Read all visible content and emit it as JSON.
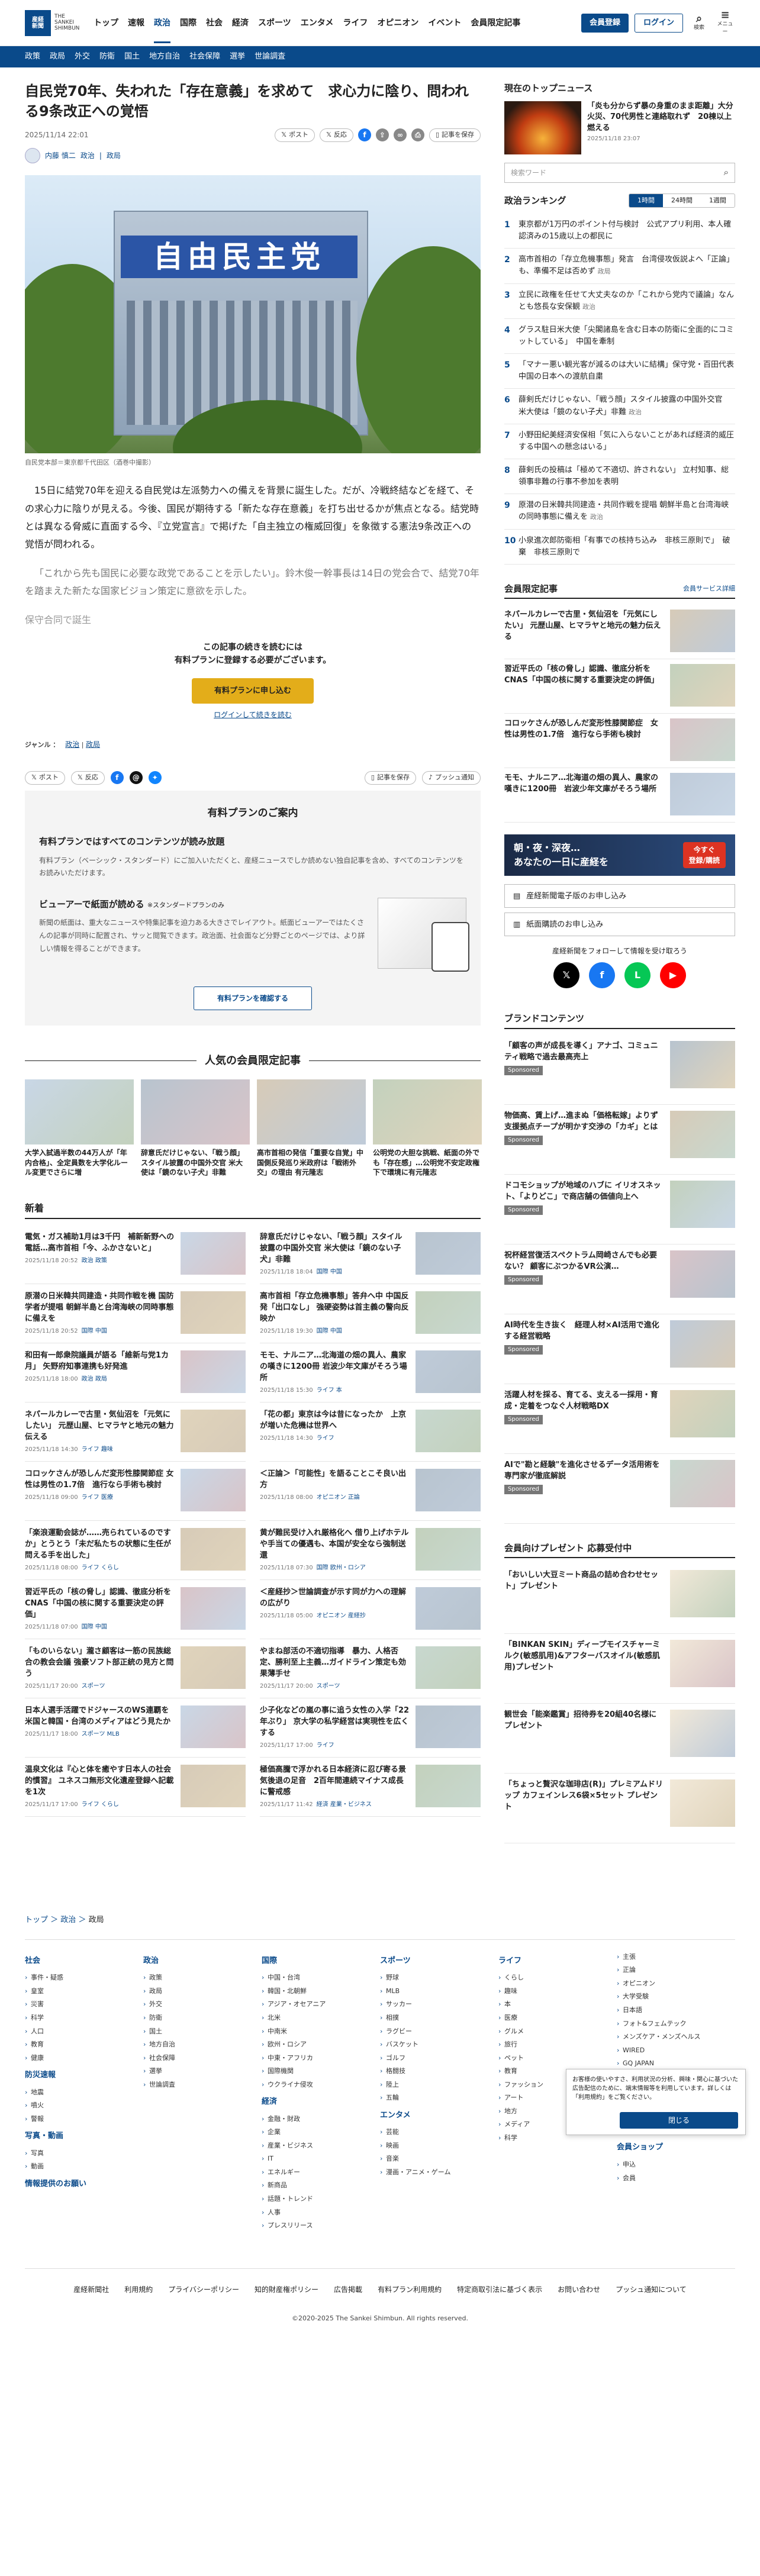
{
  "header": {
    "logo_top": "産経",
    "logo_bottom": "新聞",
    "logo_sub": "THE SANKEI SHIMBUN",
    "nav": [
      "トップ",
      "速報",
      "政治",
      "国際",
      "社会",
      "経済",
      "スポーツ",
      "エンタメ",
      "ライフ",
      "オピニオン",
      "イベント",
      "会員限定記事"
    ],
    "register": "会員登録",
    "login": "ログイン",
    "search_label": "検索",
    "menu_label": "メニュー"
  },
  "subnav": [
    "政策",
    "政局",
    "外交",
    "防衛",
    "国土",
    "地方自治",
    "社会保障",
    "選挙",
    "世論調査"
  ],
  "article": {
    "title": "自民党70年、失われた「存在意義」を求めて　求心力に陰り、問われる9条改正への覚悟",
    "date": "2025/11/14 22:01",
    "post": "ポスト",
    "anti": "反応",
    "save": "記事を保存",
    "author": "内藤 慎二",
    "cats": [
      "政治",
      "政局"
    ],
    "sign_text": "自由民主党",
    "caption": "自民党本部＝東京都千代田区（酒巻中撮影）",
    "p1": "15日に結党70年を迎える自民党は左派勢力への備えを背景に誕生した。だが、冷戦終結などを経て、その求心力に陰りが見える。今後、国民が期待する「新たな存在意義」を打ち出せるかが焦点となる。結党時とは異なる脅威に直面する今、『立党宣言』で掲げた「自主独立の権威回復」を象徴する憲法9条改正への覚悟が問われる。",
    "p2": "「これから先も国民に必要な政党であることを示したい」。鈴木俊一幹事長は14日の党会合で、結党70年を踏まえた新たな国家ビジョン策定に意欲を示した。",
    "fade": "保守合同で誕生",
    "pay1": "この記事の続きを読むには",
    "pay2": "有料プランに登録する必要がございます。",
    "pay_btn": "有料プランに申し込む",
    "pay_login": "ログインして続きを読む",
    "genre_label": "ジャンル ：",
    "genre": [
      "政治",
      "政局"
    ],
    "push": "プッシュ通知"
  },
  "plan": {
    "title": "有料プランのご案内",
    "h1": "有料プランではすべてのコンテンツが読み放題",
    "p1": "有料プラン（ベーシック・スタンダード）にご加入いただくと、産経ニュースでしか読めない独自記事を含め、すべてのコンテンツをお読みいただけます。",
    "h2": "ビューアーで紙面が読める",
    "h2sub": "※スタンダードプランのみ",
    "p2": "新聞の紙面は、重大なニュースや特集記事を迫力ある大きさでレイアウト。紙面ビューアーではたくさんの記事が同時に配置され、サッと閲覧できます。政治面、社会面など分野ごとのページでは、より詳しい情報を得ることができます。",
    "btn": "有料プランを確認する"
  },
  "popular": {
    "title": "人気の会員限定記事",
    "items": [
      "大学入試過半数の44万人が「年内合格」、全定員数を大学化ルール変更でさらに増",
      "辞意氏だけじゃない、「戦う顔」スタイル披露の中国外交官 米大使は「鏡のない子犬」非難",
      "高市首相の発信「重要な自覚」中国側反発巡り米政府は「戦術外交」の理由 有元隆志",
      "公明党の大胆な挑戦、紙面の外でも「存在感」…公明党不安定政権下で環境に有元隆志"
    ]
  },
  "news": {
    "title": "新着",
    "items": [
      {
        "t": "電気・ガス補助1月は3千円　補新新野への電話…高市首相「今、ふかさないと」",
        "d": "2025/11/18 20:52",
        "c": "政治 政策"
      },
      {
        "t": "辞意氏だけじゃない、「戦う顔」スタイル披露の中国外交官 米大使は「鏡のない子犬」非難",
        "d": "2025/11/18 18:04",
        "c": "国際 中国"
      },
      {
        "t": "原潜の日米韓共同建造・共同作戦を機 国防学者が提唱 朝鮮半島と台湾海峡の同時事態に備えを",
        "d": "2025/11/18 20:52",
        "c": "国際 中国"
      },
      {
        "t": "高市首相「存立危機事態」答弁へ中 中国反発「出口なし」 強硬姿勢は首主義の警向反映か",
        "d": "2025/11/18 19:30",
        "c": "国際 中国"
      },
      {
        "t": "和田有一郎衆院議員が語る「維新与党1カ月」 矢野府知事連携も好発進",
        "d": "2025/11/18 18:00",
        "c": "政治 政局"
      },
      {
        "t": "モモ、ナルニア…北海道の畑の異人、農家の嘆きに1200冊 岩波少年文庫がそろう場所",
        "d": "2025/11/18 15:30",
        "c": "ライフ 本"
      },
      {
        "t": "ネパールカレーで古里・気仙沼を「元気にしたい」 元歴山屋、ヒマラヤと地元の魅力伝える",
        "d": "2025/11/18 14:30",
        "c": "ライフ 趣味"
      },
      {
        "t": "「花の都」東京は今は昔になったか　上京が増いた危機は世界へ",
        "d": "2025/11/18 14:30",
        "c": "ライフ"
      },
      {
        "t": "コロッケさんが恐しんだ変形性膝関節症 女性は男性の1.7倍　進行なら手術も検討",
        "d": "2025/11/18 09:00",
        "c": "ライフ 医療"
      },
      {
        "t": "＜正論＞「可能性」を語ることこそ良い出方",
        "d": "2025/11/18 08:00",
        "c": "オピニオン 正論"
      },
      {
        "t": "「楽浪運動会誌が……売られているのですか」とうとう「未だ私たちの状態に生任が問える手を出した」",
        "d": "2025/11/18 08:00",
        "c": "ライフ くらし"
      },
      {
        "t": "黄が難民受け入れ厳格化へ 借り上げホテルや手当ての優遇も、本国が安全なら強制送還",
        "d": "2025/11/18 07:30",
        "c": "国際 欧州・ロシア"
      },
      {
        "t": "習近平氏の「核の脅し」認識、徹底分析を　CNAS「中国の核に関する重要決定の評価」",
        "d": "2025/11/18 07:00",
        "c": "国際 中国"
      },
      {
        "t": "＜産経抄＞世論調査が示す同が力への理解の広がり",
        "d": "2025/11/18 05:00",
        "c": "オピニオン 産経抄"
      },
      {
        "t": "「ものいらない」瀧さ顧客は一筋の民族総合の教会会議 強豪ソフト部正統の見方と問う",
        "d": "2025/11/17 20:00",
        "c": "スポーツ"
      },
      {
        "t": "やまね部活の不適切指導　暴力、人格否定、勝利至上主義…ガイドライン策定も効果薄手せ",
        "d": "2025/11/17 20:00",
        "c": "スポーツ"
      },
      {
        "t": "日本人選手活躍でドジャースのWS連覇を米国と韓国・台湾のメディアはどう見たか",
        "d": "2025/11/17 18:00",
        "c": "スポーツ MLB"
      },
      {
        "t": "少子化などの嵐の事に追う女性の入学「22年ぶり」 京大学の私学経営は実現性を広くする",
        "d": "2025/11/17 17:00",
        "c": "ライフ"
      },
      {
        "t": "温泉文化は『心と体を癒やす日本人の社会的慣習』 ユネスコ無形文化遺産登録へ記載を1次",
        "d": "2025/11/17 17:00",
        "c": "ライフ くらし"
      },
      {
        "t": "極価高騰で浮かれる日本経済に忍び寄る景気後退の足音　2百年間連続マイナス成長に警戒感",
        "d": "2025/11/17 11:42",
        "c": "経済 産業・ビジネス"
      }
    ]
  },
  "sidebar": {
    "top_title": "現在のトップニュース",
    "top": {
      "t": "「炎も分からず暴の身重のまま距離」大分火災、70代男性と連絡取れず　20棟以上燃える",
      "d": "2025/11/18 23:07"
    },
    "search_ph": "検索ワード",
    "rank_title": "政治ランキング",
    "tabs": [
      "1時間",
      "24時間",
      "1週間"
    ],
    "rank": [
      {
        "t": "東京都が1万円のポイント付与検討　公式アプリ利用、本人確認済みの15歳以上の都民に",
        "k": ""
      },
      {
        "t": "高市首相の「存立危機事態」発言　台湾侵攻仮説よへ「正論」も、準備不足は否めず",
        "k": "政局"
      },
      {
        "t": "立民に政権を任せて大丈夫なのか「これから党内で議論」なんとも悠長な安保観",
        "k": "政治"
      },
      {
        "t": "グラス駐日米大使「尖閣諸島を含む日本の防衛に全面的にコミットしている」　中国を牽制",
        "k": ""
      },
      {
        "t": "「マナー悪い観光客が減るのは大いに結構」保守党・百田代表　中国の日本への渡航自粛",
        "k": ""
      },
      {
        "t": "薛剣氏だけじゃない、「戦う顔」スタイル披露の中国外交官　米大使は「鏡のない子犬」非難",
        "k": "政治"
      },
      {
        "t": "小野田紀美経済安保相「気に入らないことがあれば経済的威圧する中国への懸念はいる」",
        "k": ""
      },
      {
        "t": "薛剣氏の投稿は「極めて不適切、許されない」 立村知事、総領事非難の行事不参加を表明",
        "k": ""
      },
      {
        "t": "原潜の日米韓共同建造・共同作戦を提唱 朝鮮半島と台湾海峡の同時事態に備えを",
        "k": "政治"
      },
      {
        "t": "小泉進次郎防衛相「有事での核持ち込み　非核三原則で」　破棄　非核三原則で",
        "k": ""
      }
    ],
    "lim_title": "会員限定記事",
    "lim_link": "会員サービス詳細",
    "lim": [
      "ネパールカレーで古里・気仙沼を「元気にしたい」 元歴山屋、ヒマラヤと地元の魅力伝える",
      "習近平氏の「核の脅し」認識、徹底分析を　CNAS「中国の核に関する重要決定の評価」",
      "コロッケさんが恐しんだ変形性膝関節症　女性は男性の1.7倍　進行なら手術も検討",
      "モモ、ナルニア…北海道の畑の異人、農家の嘆きに1200冊　岩波少年文庫がそろう場所"
    ],
    "banner_t": "朝・夜・深夜…\nあなたの一日に産経を",
    "banner_b": "今すぐ\n登録/購読",
    "sb1": "産経新聞電子版のお申し込み",
    "sb2": "紙面購読のお申し込み",
    "follow": "産経新聞をフォローして情報を受け取ろう",
    "brand_title": "ブランドコンテンツ",
    "sponsored": "Sponsored",
    "brand": [
      "「顧客の声が成長を導く」アナゴ、コミュニティ戦略で過去最高売上",
      "物価高、賃上げ…進まぬ「価格転嫁」よりず支援拠点チープが明かす交渉の「カギ」とは",
      "ドコモショップが地域のハブに イリオスネット、「よりどこ」で商店舗の価値向上へ",
      "祝杯経営復活スペクトラム岡崎さんでも必要ない？ 顧客にぶつかるVR公演…",
      "AI時代を生き抜く　経理人材×AI活用で進化する経営戦略",
      "活躍人材を採る、育てる、支える一採用・育成・定着をつなぐ人材戦略DX",
      "AIで\"勘と経験\"を進化させるデータ活用術を専門家が徹底解説"
    ],
    "present_title": "会員向けプレゼント 応募受付中",
    "present": [
      "「おいしい大豆ミート商品の詰め合わせセット」プレゼント",
      "「BINKAN SKIN」ディープモイスチャーミルク(敏感肌用)&アフターバスオイル(敏感肌用)プレゼント",
      "観世会「能楽鑑賞」招待券を20組40名様にプレゼント",
      "「ちょっと贅沢な珈琲店(R)」プレミアムドリップ カフェインレス6袋×5セット プレゼント"
    ]
  },
  "footer": {
    "crumb": [
      "トップ",
      "政治",
      "政局"
    ],
    "cols": [
      {
        "h": "社会",
        "items": [
          "事件・疑惑",
          "皇室",
          "災害",
          "科学",
          "人口",
          "教育",
          "健康"
        ],
        "h2": "防災速報",
        "items2": [
          "地震",
          "噴火",
          "警報"
        ],
        "h3": "写真・動画",
        "items3": [
          "写真",
          "動画"
        ],
        "h4": "情報提供のお願い"
      },
      {
        "h": "政治",
        "items": [
          "政策",
          "政局",
          "外交",
          "防衛",
          "国土",
          "地方自治",
          "社会保障",
          "選挙",
          "世論調査"
        ]
      },
      {
        "h": "国際",
        "items": [
          "中国・台湾",
          "韓国・北朝鮮",
          "アジア・オセアニア",
          "北米",
          "中南米",
          "欧州・ロシア",
          "中東・アフリカ",
          "国際機関",
          "ウクライナ侵攻"
        ],
        "h2": "経済",
        "items2": [
          "金融・財政",
          "企業",
          "産業・ビジネス",
          "IT",
          "エネルギー",
          "新商品",
          "話題・トレンド",
          "人事",
          "プレスリリース"
        ]
      },
      {
        "h": "スポーツ",
        "items": [
          "野球",
          "MLB",
          "サッカー",
          "相撲",
          "ラグビー",
          "バスケット",
          "ゴルフ",
          "格闘技",
          "陸上",
          "五輪"
        ],
        "h2": "エンタメ",
        "items2": [
          "芸能",
          "映画",
          "音楽",
          "漫画・アニメ・ゲーム"
        ]
      },
      {
        "h": "ライフ",
        "items": [
          "くらし",
          "趣味",
          "本",
          "医療",
          "グルメ",
          "旅行",
          "ペット",
          "教育",
          "ファッション",
          "アート",
          "地方",
          "メディア",
          "科学"
        ]
      },
      {
        "h": "",
        "items": [
          "主張",
          "正論",
          "オピニオン",
          "大学受験",
          "日本語",
          "フォト&フェムテック",
          "メンズケア・メンズヘルス",
          "WIRED",
          "GQ JAPAN",
          "ハシスポーツ",
          "実技",
          "新着動画",
          "学び合い",
          "産業取材"
        ],
        "h2": "会員ショップ",
        "items2": [
          "申込",
          "会員"
        ]
      }
    ],
    "links": [
      "産経新聞社",
      "利用規約",
      "プライバシーポリシー",
      "知的財産権ポリシー",
      "広告掲載",
      "有料プラン利用規約",
      "特定商取引法に基づく表示",
      "お問い合わせ",
      "プッシュ通知について"
    ],
    "copy": "©2020-2025 The Sankei Shimbun. All rights reserved.",
    "cookie_text": "お客様の使いやすさ、利用状況の分析、興味・関心に基づいた広告配信のために、端末情報等を利用しています。詳しくは「利用規約」をご覧ください。",
    "cookie_btn": "閉じる"
  }
}
